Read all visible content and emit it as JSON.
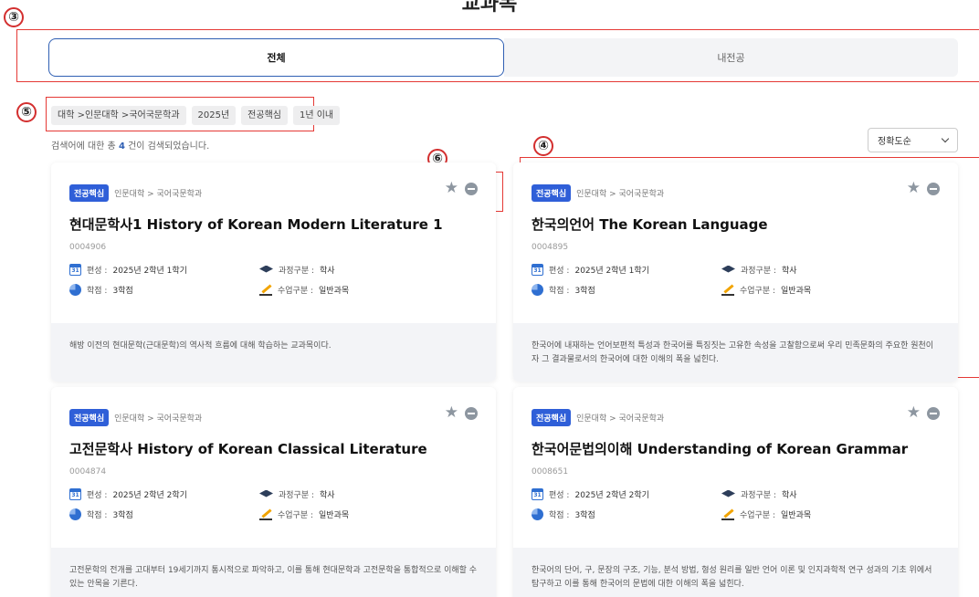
{
  "page": {
    "title": "교과목"
  },
  "callouts": {
    "c3": "③",
    "c4": "④",
    "c5": "⑤",
    "c6": "⑥"
  },
  "tabs": {
    "all": "전체",
    "my_major": "내전공"
  },
  "filters": [
    "대학 >인문대학 >국어국문학과",
    "2025년",
    "전공핵심",
    "1년 이내"
  ],
  "results": {
    "prefix": "검색어에 대한 총 ",
    "count": "4",
    "suffix": " 건이 검색되었습니다."
  },
  "sort": {
    "selected": "정확도순"
  },
  "labels": {
    "schedule": "편성 :",
    "credits": "학점 :",
    "program": "과정구분 :",
    "class_type": "수업구분 :"
  },
  "courses": [
    {
      "badge": "전공핵심",
      "dept": "인문대학 > 국어국문학과",
      "title": "현대문학사1 History of Korean Modern Literature 1",
      "code": "0004906",
      "schedule": "2025년 2학년 1학기",
      "credits": "3학점",
      "program": "학사",
      "class_type": "일반과목",
      "description": "해방 이전의 현대문학(근대문학)의 역사적 흐름에 대해 학습하는 교과목이다."
    },
    {
      "badge": "전공핵심",
      "dept": "인문대학 > 국어국문학과",
      "title": "한국의언어 The Korean Language",
      "code": "0004895",
      "schedule": "2025년 2학년 1학기",
      "credits": "3학점",
      "program": "학사",
      "class_type": "일반과목",
      "description": "한국어에 내재하는 언어보편적 특성과 한국어를 특징짓는 고유한 속성을 고찰함으로써 우리 민족문화의 주요한 원천이자 그 결과물로서의 한국어에 대한 이해의 폭을 넓힌다."
    },
    {
      "badge": "전공핵심",
      "dept": "인문대학 > 국어국문학과",
      "title": "고전문학사 History of Korean Classical Literature",
      "code": "0004874",
      "schedule": "2025년 2학년 2학기",
      "credits": "3학점",
      "program": "학사",
      "class_type": "일반과목",
      "description": "고전문학의 전개를 고대부터 19세기까지 통시적으로 파악하고, 이를 통해 현대문학과 고전문학을 통합적으로 이해할 수 있는 안목을 기른다."
    },
    {
      "badge": "전공핵심",
      "dept": "인문대학 > 국어국문학과",
      "title": "한국어문법의이해 Understanding of Korean Grammar",
      "code": "0008651",
      "schedule": "2025년 2학년 2학기",
      "credits": "3학점",
      "program": "학사",
      "class_type": "일반과목",
      "description": "한국어의 단어, 구, 문장의 구조, 기능, 분석 방법, 형성 원리를 일반 언어 이론 및 인지과학적 연구 성과의 기초 위에서 탐구하고 이를 통해 한국어의 문법에 대한 이해의 폭을 넓힌다."
    }
  ],
  "colors": {
    "accent": "#2f5fd8",
    "annotation": "#e53935"
  },
  "icons": [
    "star-icon",
    "remove-icon",
    "calendar-icon",
    "pie-icon",
    "graduation-cap-icon",
    "pencil-icon",
    "chevron-down-icon"
  ]
}
